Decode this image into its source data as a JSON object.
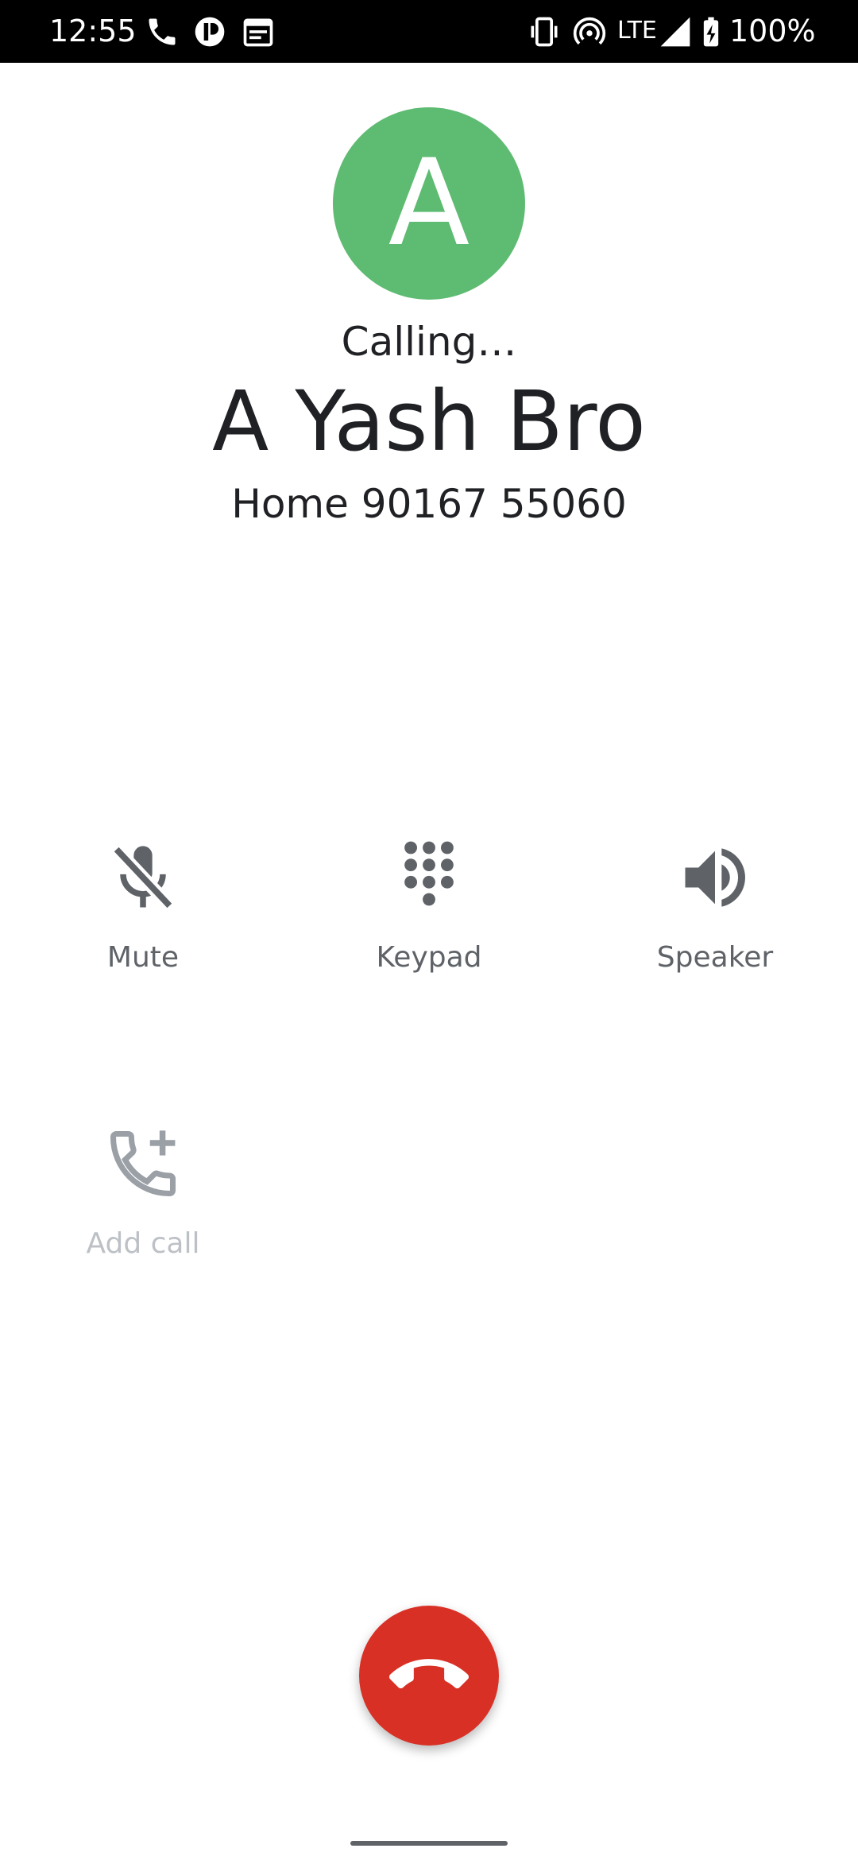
{
  "status_bar": {
    "time": "12:55",
    "network": "LTE",
    "battery": "100%",
    "icons": {
      "left": [
        "phone-icon",
        "app-notification-icon",
        "calendar-icon"
      ],
      "right": [
        "vibrate-icon",
        "hotspot-icon",
        "signal-icon",
        "battery-charging-icon"
      ]
    }
  },
  "caller": {
    "avatar_letter": "A",
    "avatar_color": "#5ebb72",
    "status": "Calling…",
    "name": "A Yash Bro",
    "number": "Home 90167 55060"
  },
  "actions": {
    "mute": {
      "label": "Mute",
      "icon": "mic-off-icon"
    },
    "keypad": {
      "label": "Keypad",
      "icon": "dialpad-icon"
    },
    "speaker": {
      "label": "Speaker",
      "icon": "volume-up-icon"
    },
    "add_call": {
      "label": "Add call",
      "icon": "add-call-icon",
      "enabled": false
    }
  },
  "end_call": {
    "icon": "call-end-icon",
    "color": "#d93025"
  },
  "colors": {
    "status_bar": "#000000",
    "text_primary": "#202124",
    "text_secondary": "#5f6368",
    "text_disabled": "#bdc1c6"
  }
}
